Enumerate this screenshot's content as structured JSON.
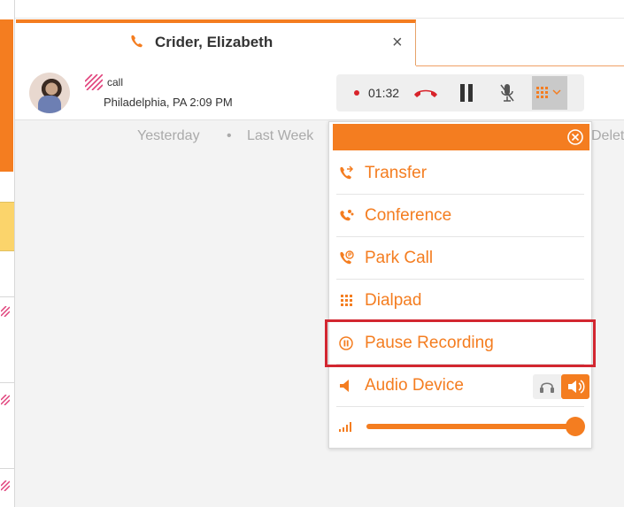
{
  "tab": {
    "title": "Crider, Elizabeth",
    "close": "×"
  },
  "call": {
    "type": "call",
    "location": "Philadelphia, PA 2:09 PM",
    "timer": "01:32"
  },
  "filters": [
    "Yesterday",
    "Last Week",
    "Delete"
  ],
  "filter_separator": "•",
  "menu": {
    "items": [
      {
        "label": "Transfer",
        "icon": "transfer-icon"
      },
      {
        "label": "Conference",
        "icon": "conference-icon"
      },
      {
        "label": "Park Call",
        "icon": "park-call-icon"
      },
      {
        "label": "Dialpad",
        "icon": "dialpad-icon"
      },
      {
        "label": "Pause Recording",
        "icon": "pause-recording-icon"
      },
      {
        "label": "Audio Device",
        "icon": "audio-device-icon"
      }
    ],
    "volume_level": 1.0
  },
  "colors": {
    "accent": "#f47d20",
    "highlight": "#d22630",
    "recording": "#d8232a"
  }
}
